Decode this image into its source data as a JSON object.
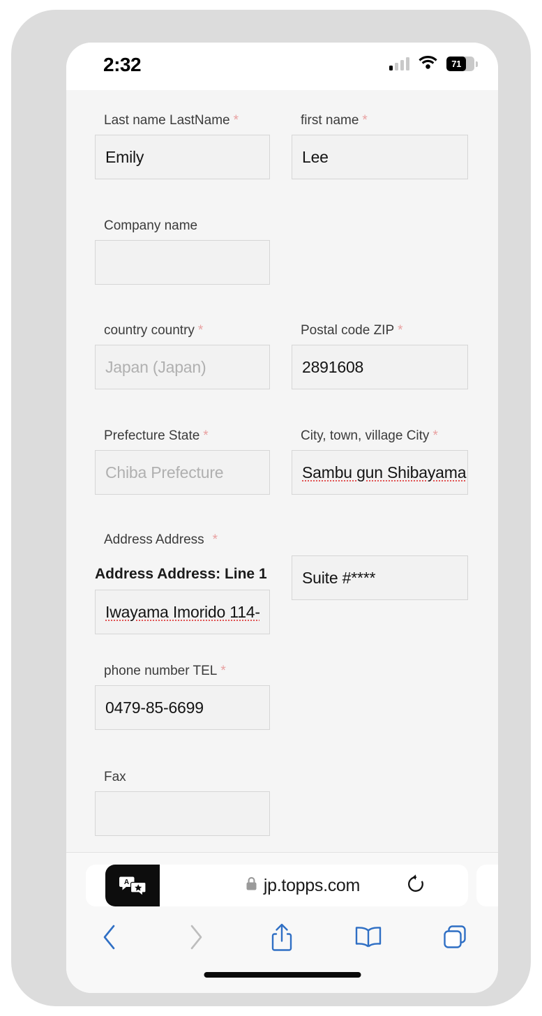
{
  "status_bar": {
    "time": "2:32",
    "battery_percent": "71",
    "battery_level": 71,
    "signal_icon": "cellular-signal-icon",
    "wifi_icon": "wifi-icon",
    "battery_icon": "battery-icon"
  },
  "form": {
    "required_marker": "*",
    "fields": [
      {
        "name": "last-name",
        "label": "Last name LastName",
        "required": true,
        "value": "Emily",
        "placeholder": "",
        "is_placeholder": false,
        "spellcheck_error": false
      },
      {
        "name": "first-name",
        "label": "first name",
        "required": true,
        "value": "Lee",
        "placeholder": "",
        "is_placeholder": false,
        "spellcheck_error": false
      },
      {
        "name": "company-name",
        "label": "Company name",
        "required": false,
        "value": "",
        "placeholder": "",
        "is_placeholder": false,
        "spellcheck_error": false
      },
      {
        "name": "country",
        "label": "country country",
        "required": true,
        "value": "Japan (Japan)",
        "placeholder": "Japan (Japan)",
        "is_placeholder": true,
        "spellcheck_error": false
      },
      {
        "name": "postal-code",
        "label": "Postal code ZIP",
        "required": true,
        "value": "2891608",
        "placeholder": "",
        "is_placeholder": false,
        "spellcheck_error": false
      },
      {
        "name": "prefecture",
        "label": "Prefecture State",
        "required": true,
        "value": "Chiba Prefecture",
        "placeholder": "Chiba Prefecture",
        "is_placeholder": true,
        "spellcheck_error": false
      },
      {
        "name": "city",
        "label": "City, town, village City",
        "required": true,
        "value": "Sambu gun Shibayama",
        "placeholder": "",
        "is_placeholder": false,
        "spellcheck_error": true
      },
      {
        "name": "address",
        "label": "Address Address",
        "required": true,
        "sub_label": "Address Address: Line 1",
        "value": "Iwayama Imorido 114-",
        "placeholder": "",
        "is_placeholder": false,
        "spellcheck_error": true
      },
      {
        "name": "address-line-2",
        "label": "",
        "required": false,
        "value": "Suite #****",
        "placeholder": "Suite #****",
        "is_placeholder": false,
        "spellcheck_error": false
      },
      {
        "name": "phone-number",
        "label": "phone number TEL",
        "required": true,
        "value": "0479-85-6699",
        "placeholder": "",
        "is_placeholder": false,
        "spellcheck_error": false
      },
      {
        "name": "fax",
        "label": "Fax",
        "required": false,
        "value": "",
        "placeholder": "",
        "is_placeholder": false,
        "spellcheck_error": false
      }
    ]
  },
  "browser": {
    "url": "jp.topps.com",
    "lock_icon": "lock-icon",
    "translate_icon": "translate-icon",
    "reload_icon": "reload-icon",
    "toolbar": [
      {
        "name": "back-button",
        "icon": "chevron-left-icon",
        "enabled": true
      },
      {
        "name": "forward-button",
        "icon": "chevron-right-icon",
        "enabled": false
      },
      {
        "name": "share-button",
        "icon": "share-icon",
        "enabled": true
      },
      {
        "name": "bookmarks-button",
        "icon": "book-icon",
        "enabled": true
      },
      {
        "name": "tabs-button",
        "icon": "tabs-icon",
        "enabled": true
      }
    ]
  },
  "colors": {
    "accent_blue": "#2f6fc4",
    "disabled_gray": "#bdbdbd",
    "required_red": "#e8a0a0",
    "spell_error_red": "#e05252",
    "page_bg": "#f5f5f5",
    "device_frame": "#dcdcdc"
  }
}
